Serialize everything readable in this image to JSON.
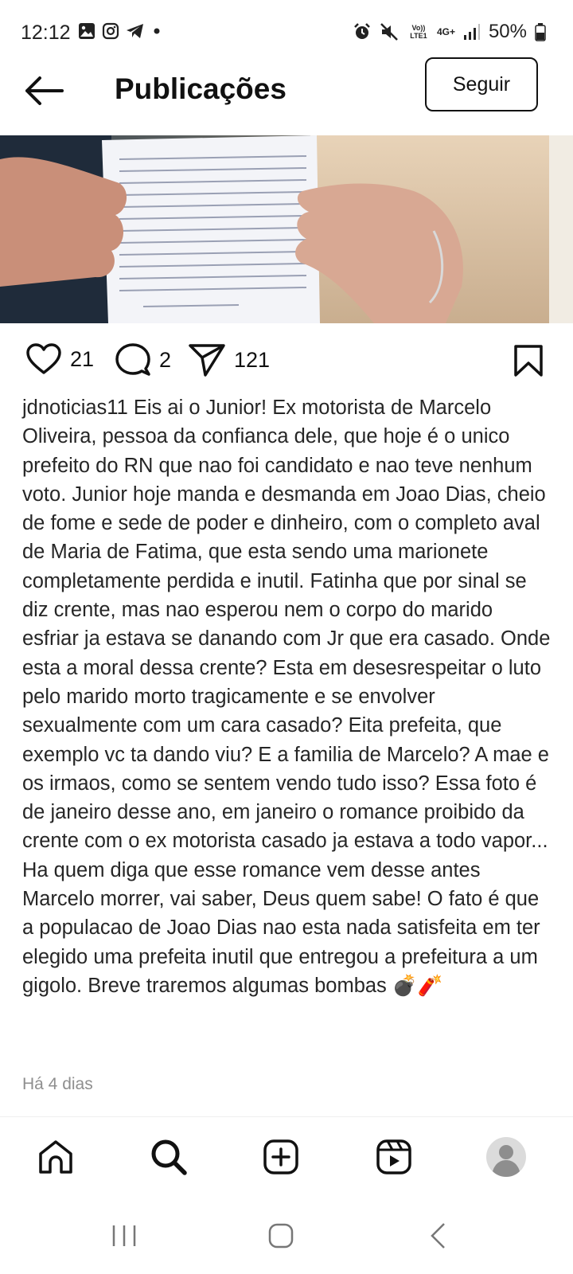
{
  "status_bar": {
    "time": "12:12",
    "battery_text": "50%",
    "volte_tag": "Vo)) LTE1",
    "network_tag": "4G+",
    "icons": [
      "image-icon",
      "instagram-icon",
      "telegram-icon",
      "dot-icon",
      "alarm-icon",
      "mute-icon",
      "signal-icon",
      "battery-icon"
    ]
  },
  "header": {
    "title": "Publicações",
    "follow_label": "Seguir"
  },
  "post": {
    "likes": "21",
    "comments": "2",
    "shares": "121",
    "username": "jdnoticias11",
    "caption": "Eis ai o Junior! Ex motorista de Marcelo Oliveira, pessoa da confianca dele, que hoje é o unico prefeito do RN que nao foi candidato e nao teve nenhum voto. Junior hoje manda e desmanda em Joao Dias, cheio de fome e sede de poder e dinheiro, com o completo aval de Maria de Fatima, que esta sendo uma marionete completamente perdida e inutil. Fatinha que por sinal se diz crente, mas nao esperou nem o corpo do marido esfriar ja estava se danando com Jr que era casado. Onde esta a moral dessa crente? Esta em desesrespeitar o luto pelo marido morto tragicamente e se envolver sexualmente com um cara casado? Eita prefeita, que exemplo vc ta dando viu? E a familia de Marcelo? A mae e os irmaos, como se sentem vendo tudo isso? Essa foto é de janeiro desse ano, em janeiro o romance proibido da crente com o ex motorista casado ja estava a todo vapor... Ha quem diga que esse romance vem desse antes Marcelo morrer, vai saber, Deus quem sabe! O fato é que a populacao de Joao Dias nao esta nada satisfeita em ter elegido uma prefeita inutil que entregou a prefeitura a um gigolo. Breve traremos algumas bombas 💣🧨",
    "time_ago": "Há 4 dias"
  },
  "colors": {
    "text": "#262626",
    "muted": "#8e8e8e",
    "icon": "#111111"
  },
  "bottom_nav": [
    "home-icon",
    "search-icon",
    "create-icon",
    "reels-icon",
    "profile-avatar"
  ],
  "system_nav": [
    "recent-apps-button",
    "home-button",
    "back-button"
  ]
}
